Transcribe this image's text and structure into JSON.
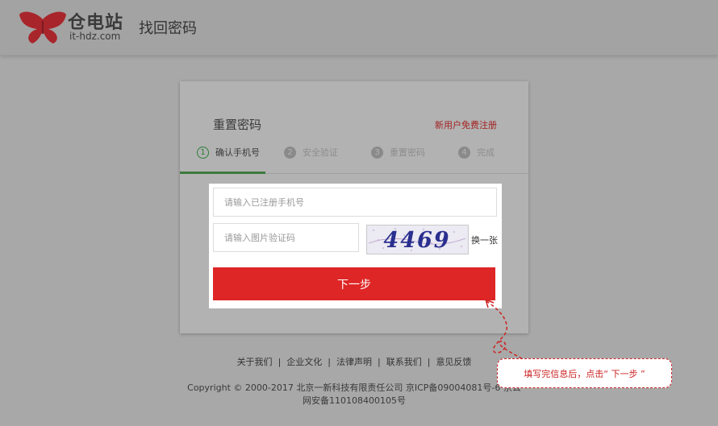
{
  "header": {
    "logo_cn": "仓电站",
    "logo_en": "it-hdz.com",
    "page_title": "找回密码"
  },
  "card": {
    "title": "重置密码",
    "register_link": "新用户免费注册",
    "steps": [
      {
        "num": "1",
        "label": "确认手机号"
      },
      {
        "num": "2",
        "label": "安全验证"
      },
      {
        "num": "3",
        "label": "重置密码"
      },
      {
        "num": "4",
        "label": "完成"
      }
    ]
  },
  "form": {
    "phone_placeholder": "请输入已注册手机号",
    "captcha_placeholder": "请输入图片验证码",
    "captcha_text": "4469",
    "refresh_label": "换一张",
    "next_button": "下一步"
  },
  "footer": {
    "links": [
      "关于我们",
      "企业文化",
      "法律声明",
      "联系我们",
      "意见反馈"
    ],
    "copyright_line1": "Copyright © 2000-2017 北京一新科技有限责任公司 京ICP备09004081号-6 京公",
    "copyright_line2": "网安备110108400105号"
  },
  "callout": {
    "text": "填写完信息后，点击“ 下一步 ”"
  },
  "colors": {
    "accent_red": "#de2626",
    "step_green": "#2e7d36",
    "annotation_red": "#cc2222"
  }
}
